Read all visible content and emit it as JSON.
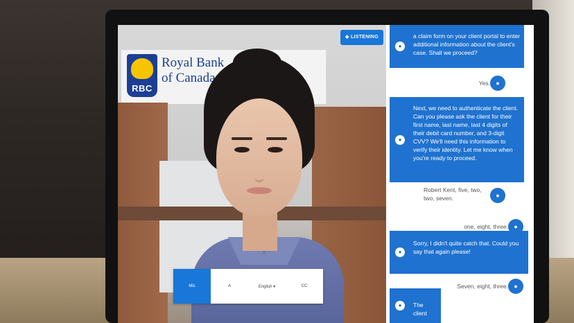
{
  "brand": {
    "name_line1": "Royal Bank",
    "name_line2": "of Canada",
    "logo_text": "RBC",
    "primary_color": "#1c3f95",
    "accent_color": "#f7c400"
  },
  "status": {
    "listening_label": "◆ LISTENING",
    "color": "#1877d8"
  },
  "toolbar": {
    "items": [
      "Mic",
      "A",
      "English ▾",
      "CC"
    ]
  },
  "chat": {
    "bot_color": "#1f72cf",
    "messages": [
      {
        "role": "bot",
        "text": "a claim form on your client portal to enter additional information about the client's case. Shall we proceed?"
      },
      {
        "role": "user",
        "text": "Yes."
      },
      {
        "role": "bot",
        "text": "Next, we need to authenticate the client. Can you please ask the client for their first name, last name, last 4 digits of their debit card number, and 3-digit CVV? We'll need this information to verify their identity. Let me know when you're ready to proceed."
      },
      {
        "role": "user",
        "text": "Robert Kent, five, two, two, seven."
      },
      {
        "role": "user",
        "text": "one, eight, three."
      },
      {
        "role": "bot",
        "text": "Sorry, I didn't quite catch that. Could you say that again please!"
      },
      {
        "role": "user",
        "text": "Seven, eight, three."
      },
      {
        "role": "bot",
        "text": "The client"
      }
    ]
  }
}
